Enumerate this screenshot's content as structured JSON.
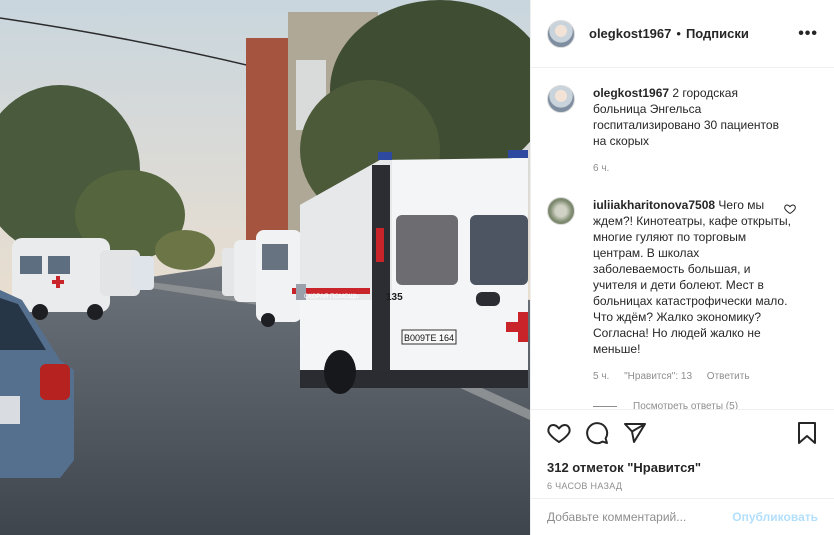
{
  "post": {
    "author": "olegkost1967",
    "separator": "•",
    "follow_label": "Подписки",
    "more_label": "•••"
  },
  "caption": {
    "author": "olegkost1967",
    "text": "2 городская больница Энгельса госпитализировано 30 пациентов на скорых",
    "age": "6 ч."
  },
  "comment": {
    "author": "iuliiakharitonova7508",
    "text": "Чего мы ждем?! Кинотеатры, кафе открыты, многие гуляют по торговым центрам. В школах заболеваемость большая, и учителя и дети болеют. Мест в больницах катастрофически мало. Что ждём? Жалко экономику? Согласна! Но людей жалко не меньше!",
    "age": "5 ч.",
    "likes": "\"Нравится\": 13",
    "reply_label": "Ответить",
    "view_replies": "Посмотреть ответы (5)"
  },
  "photo": {
    "ambulance_number": "135",
    "plate": "В009ТЕ 164",
    "side_text": "СКОРАЯ ПОМОЩЬ"
  },
  "stats": {
    "likes": "312 отметок \"Нравится\"",
    "time": "6 ЧАСОВ НАЗАД"
  },
  "composer": {
    "placeholder": "Добавьте комментарий...",
    "publish": "Опубликовать"
  },
  "icons": {
    "like": "heart-icon",
    "comment": "comment-icon",
    "share": "share-icon",
    "save": "bookmark-icon",
    "comment_like": "heart-icon"
  }
}
